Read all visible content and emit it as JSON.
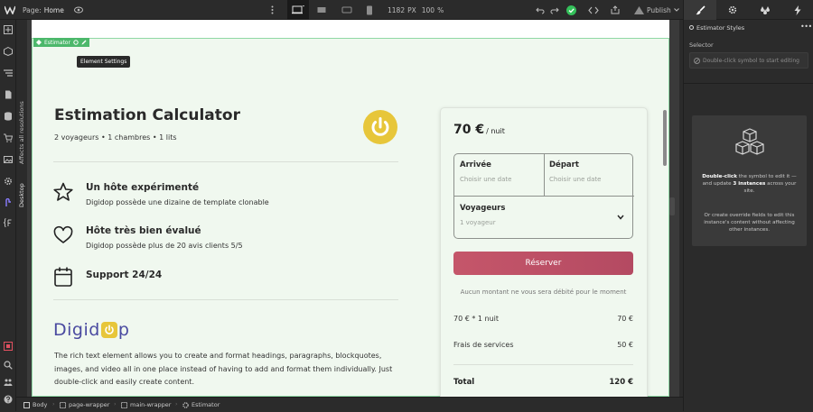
{
  "topbar": {
    "page_label": "Page:",
    "page_name": "Home",
    "width_value": "1182",
    "width_unit": "PX",
    "zoom_value": "100",
    "zoom_unit": "%",
    "publish_label": "Publish"
  },
  "side_labels": {
    "affects": "Affects all resolutions",
    "device": "Desktop"
  },
  "selection": {
    "tag_label": "Estimator",
    "tooltip": "Element Settings"
  },
  "main": {
    "title": "Estimation Calculator",
    "subtitle": "2 voyageurs • 1 chambres • 1 lits",
    "features": [
      {
        "title": "Un hôte expérimenté",
        "desc": "Digidop possède une dizaine de template clonable"
      },
      {
        "title": "Hôte très bien évalué",
        "desc": "Digidop possède plus de 20 avis clients 5/5"
      },
      {
        "title": "Support 24/24",
        "desc": ""
      }
    ],
    "brand_start": "Digid",
    "brand_end": "p",
    "rich_text": "The rich text element allows you to create and format headings, paragraphs, blockquotes, images, and video all in one place instead of having to add and format them individually. Just double-click and easily create content."
  },
  "booking": {
    "price": "70 €",
    "per": "/ nuit",
    "arrival_label": "Arrivée",
    "arrival_placeholder": "Choisir une date",
    "departure_label": "Départ",
    "departure_placeholder": "Choisir une date",
    "guests_label": "Voyageurs",
    "guests_value": "1 voyageur",
    "button_label": "Réserver",
    "note": "Aucun montant ne vous sera débité pour le moment",
    "rows": [
      {
        "label": "70 € * 1 nuit",
        "value": "70 €"
      },
      {
        "label": "Frais de services",
        "value": "50 €"
      }
    ],
    "total_label": "Total",
    "total_value": "120 €"
  },
  "right_panel": {
    "style_name": "Estimator Styles",
    "selector_label": "Selector",
    "selector_placeholder": "Double-click symbol to start editing",
    "info_bold1": "Double-click",
    "info_text1": " the symbol to edit it — and update ",
    "info_bold2": "3 instances",
    "info_text2": " across your site.",
    "info_text3": "Or create override fields to edit this instance's content without affecting other instances."
  },
  "breadcrumbs": [
    "Body",
    "page-wrapper",
    "main-wrapper",
    "Estimator"
  ],
  "colors": {
    "accent_green": "#4cb86b",
    "button": "#c5566a",
    "logo_yellow": "#e7c63a",
    "brand_blue": "#4a4aa0"
  }
}
